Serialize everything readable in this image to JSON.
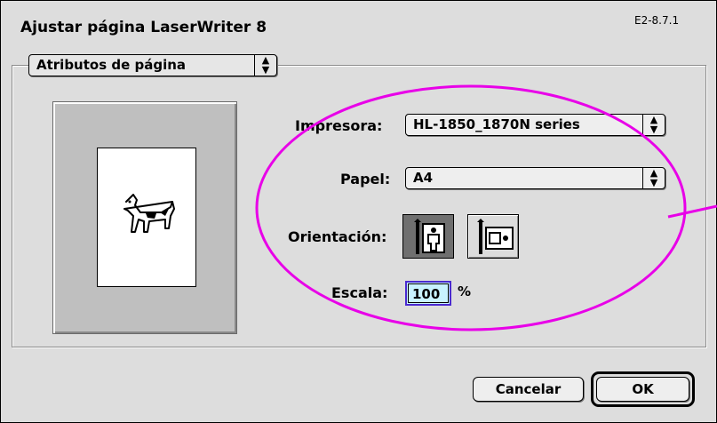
{
  "window": {
    "title": "Ajustar página LaserWriter 8",
    "version": "E2-8.7.1"
  },
  "section_menu": {
    "value": "Atributos de página",
    "arrow_glyph": "⬍"
  },
  "form": {
    "printer_label": "Impresora:",
    "printer_value": "HL-1850_1870N series",
    "paper_label": "Papel:",
    "paper_value": "A4",
    "orientation_label": "Orientación:",
    "orientation_selected": "portrait",
    "scale_label": "Escala:",
    "scale_value": "100",
    "scale_unit": "%"
  },
  "buttons": {
    "cancel": "Cancelar",
    "ok": "OK"
  },
  "colors": {
    "annotation_ellipse": "#e800e8",
    "scale_field_bg": "#c9f3ff",
    "scale_focus_ring": "#4a2ad0"
  },
  "icons": {
    "preview": "dogcow-icon",
    "portrait": "portrait-orientation-icon",
    "landscape": "landscape-orientation-icon"
  }
}
